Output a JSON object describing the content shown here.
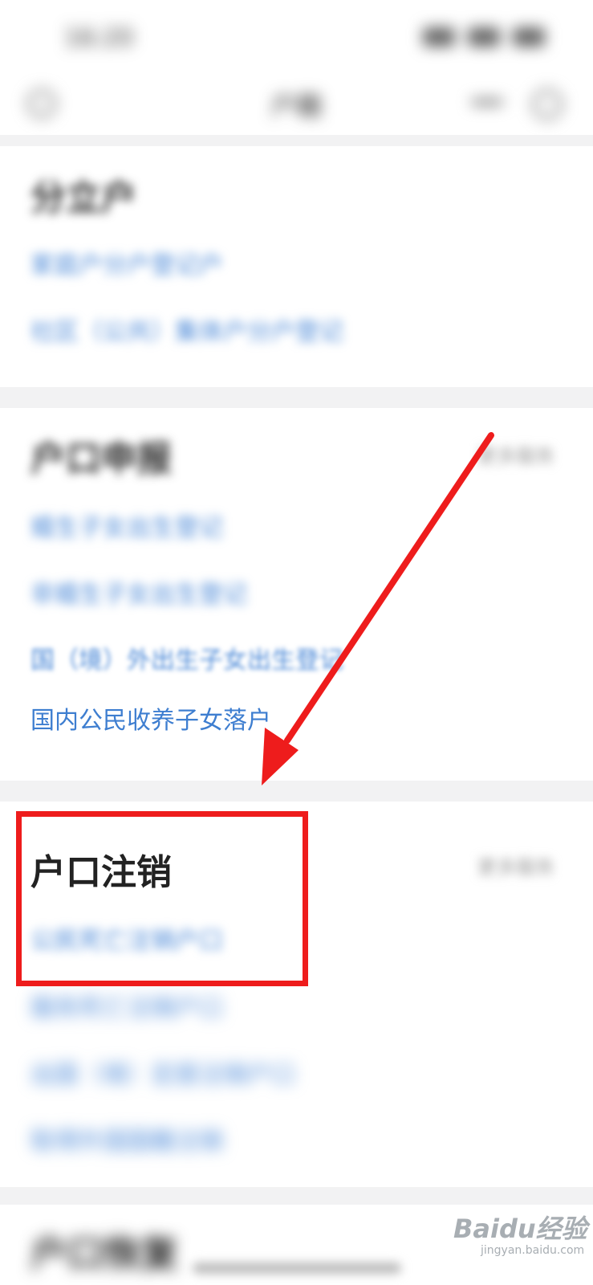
{
  "status_bar": {
    "time": "16:20"
  },
  "nav": {
    "title": "户籍"
  },
  "section1": {
    "title": "分立户",
    "links": [
      "家庭户分户登记户",
      "社区（公共）集体户分户登记"
    ]
  },
  "section2": {
    "title": "户口申报",
    "more": "更多服务",
    "links": [
      "婚生子女出生登记",
      "非婚生子女出生登记",
      "国（境）外出生子女出生登记",
      "国内公民收养子女落户"
    ]
  },
  "section3": {
    "title": "户口注销",
    "more": "更多服务",
    "links": [
      "公民死亡注销户口",
      "服务死亡注销户口",
      "出国（境）定居注销户口",
      "取得外国国籍注销"
    ]
  },
  "section4": {
    "title": "户口恢复"
  },
  "watermark": {
    "brand": "Baidu经验",
    "url": "jingyan.baidu.com"
  },
  "colors": {
    "link": "#4a88d7",
    "highlight": "#ee1c1c"
  }
}
